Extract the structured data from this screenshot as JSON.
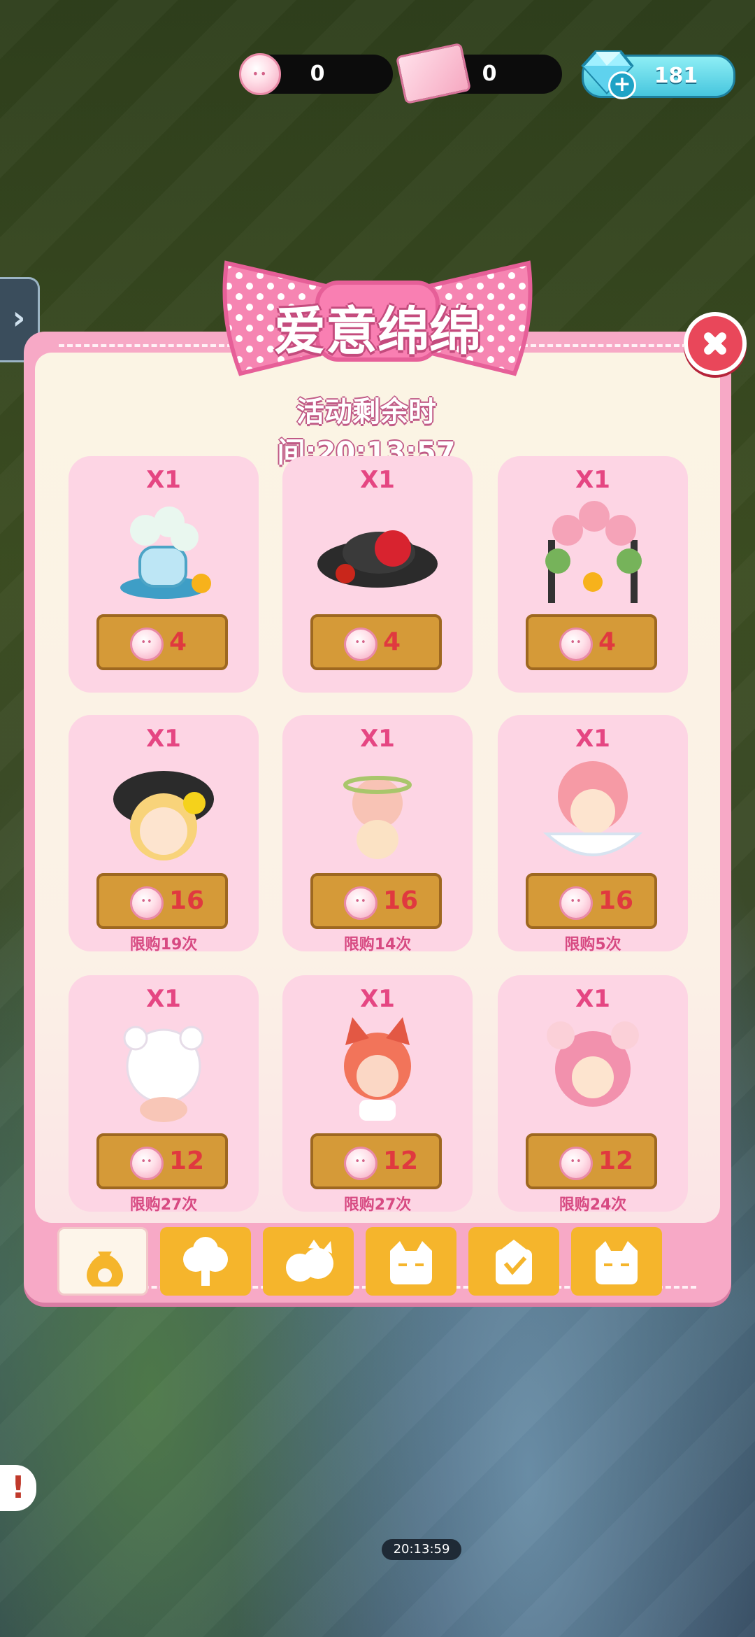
{
  "currency": {
    "coin": "0",
    "ticket": "0",
    "gem": "181"
  },
  "panel": {
    "title": "爱意绵绵",
    "timer": "活动剩余时间:20:13:57"
  },
  "items": [
    {
      "qty": "X1",
      "price": "4",
      "limit": "",
      "icon": "vase-flowers-item"
    },
    {
      "qty": "X1",
      "price": "4",
      "limit": "",
      "icon": "rose-hat-item"
    },
    {
      "qty": "X1",
      "price": "4",
      "limit": "",
      "icon": "rose-arch-item"
    },
    {
      "qty": "X1",
      "price": "16",
      "limit": "限购19次",
      "icon": "cap-girl-character"
    },
    {
      "qty": "X1",
      "price": "16",
      "limit": "限购14次",
      "icon": "flower-fairy-character"
    },
    {
      "qty": "X1",
      "price": "16",
      "limit": "限购5次",
      "icon": "teacup-girl-character"
    },
    {
      "qty": "X1",
      "price": "12",
      "limit": "限购27次",
      "icon": "white-bear-character"
    },
    {
      "qty": "X1",
      "price": "12",
      "limit": "限购27次",
      "icon": "fox-character"
    },
    {
      "qty": "X1",
      "price": "12",
      "limit": "限购24次",
      "icon": "pink-hair-bear-character"
    }
  ],
  "tabs": [
    {
      "icon": "bag-icon",
      "active": true
    },
    {
      "icon": "tree-icon",
      "active": false
    },
    {
      "icon": "twin-pets-icon",
      "active": false
    },
    {
      "icon": "cat-face-icon",
      "active": false
    },
    {
      "icon": "heart-box-icon",
      "active": false
    },
    {
      "icon": "cat-face-icon",
      "active": false
    }
  ],
  "world": {
    "bottom_timer": "20:13:59",
    "alert": "!"
  },
  "colors": {
    "panel_pink": "#f7a9c6",
    "card_pink": "#fdd5e4",
    "button_gold": "#d59a38",
    "price_red": "#e0393f",
    "tab_yellow": "#f5b52c"
  }
}
